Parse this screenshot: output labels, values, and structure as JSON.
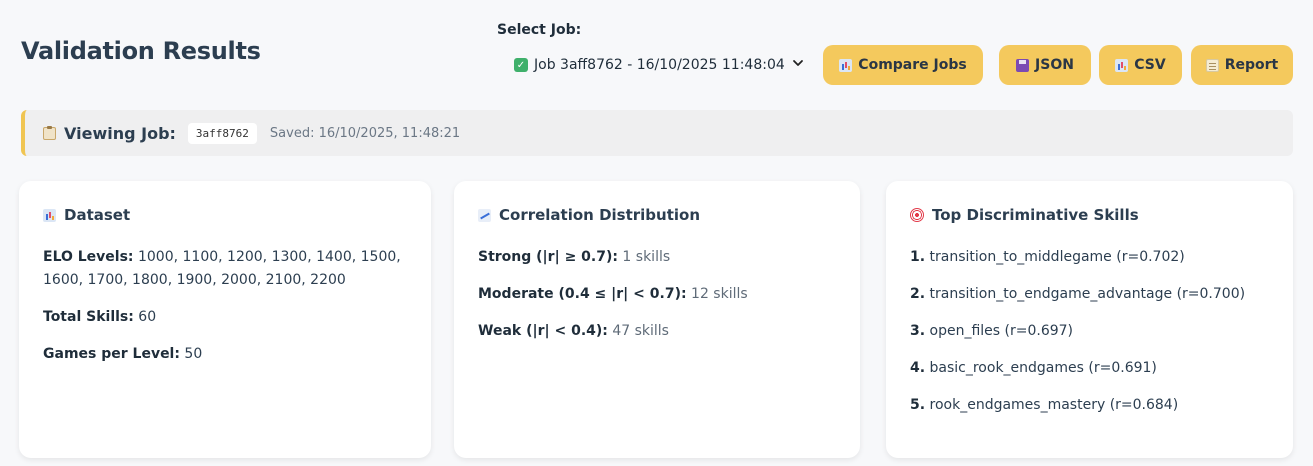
{
  "header": {
    "title": "Validation Results",
    "select_label": "Select Job:",
    "selected_job": "Job 3aff8762 - 16/10/2025 11:48:04",
    "buttons": {
      "compare": "Compare Jobs",
      "json": "JSON",
      "csv": "CSV",
      "report": "Report"
    }
  },
  "banner": {
    "title": "Viewing Job:",
    "job_id": "3aff8762",
    "saved": "Saved: 16/10/2025, 11:48:21"
  },
  "dataset": {
    "title": "Dataset",
    "elo_label": "ELO Levels:",
    "elo_value": "1000, 1100, 1200, 1300, 1400, 1500, 1600, 1700, 1800, 1900, 2000, 2100, 2200",
    "skills_label": "Total Skills:",
    "skills_value": "60",
    "games_label": "Games per Level:",
    "games_value": "50"
  },
  "correlation": {
    "title": "Correlation Distribution",
    "rows": [
      {
        "label": "Strong (|r| ≥ 0.7):",
        "value": "1 skills"
      },
      {
        "label": "Moderate (0.4 ≤ |r| < 0.7):",
        "value": "12 skills"
      },
      {
        "label": "Weak (|r| < 0.4):",
        "value": "47 skills"
      }
    ]
  },
  "top_skills": {
    "title": "Top Discriminative Skills",
    "items": [
      {
        "rank": "1.",
        "text": "transition_to_middlegame (r=0.702)"
      },
      {
        "rank": "2.",
        "text": "transition_to_endgame_advantage (r=0.700)"
      },
      {
        "rank": "3.",
        "text": "open_files (r=0.697)"
      },
      {
        "rank": "4.",
        "text": "basic_rook_endgames (r=0.691)"
      },
      {
        "rank": "5.",
        "text": "rook_endgames_mastery (r=0.684)"
      }
    ]
  },
  "colors": {
    "accent_button": "#f4c95d",
    "banner_border": "#f0c552",
    "text_primary": "#2c3e50"
  },
  "icons": {
    "select_option": "check-icon",
    "compare": "chart-icon",
    "json": "floppy-disk-icon",
    "csv": "chart-icon",
    "report": "document-icon",
    "banner": "clipboard-icon",
    "dataset": "chart-icon",
    "correlation": "trend-up-icon",
    "top_skills": "target-icon"
  }
}
